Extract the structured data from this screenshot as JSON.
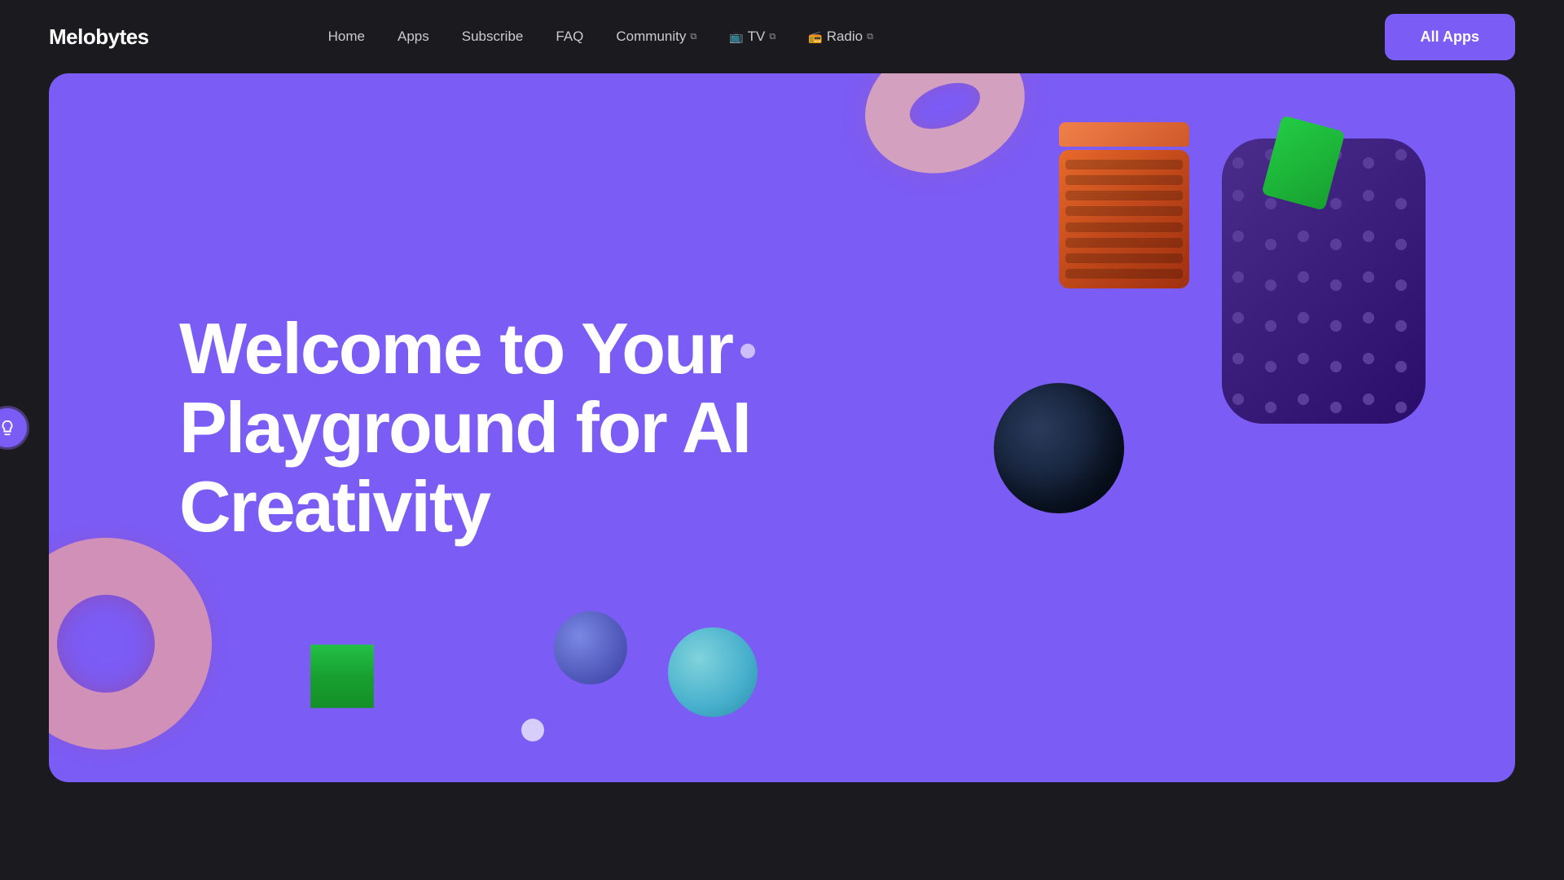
{
  "brand": {
    "name": "Melobytes"
  },
  "nav": {
    "links": [
      {
        "label": "Home",
        "external": false,
        "id": "home"
      },
      {
        "label": "Apps",
        "external": false,
        "id": "apps"
      },
      {
        "label": "Subscribe",
        "external": false,
        "id": "subscribe"
      },
      {
        "label": "FAQ",
        "external": false,
        "id": "faq"
      },
      {
        "label": "Community",
        "external": true,
        "id": "community"
      },
      {
        "label": "TV",
        "external": true,
        "id": "tv"
      },
      {
        "label": "Radio",
        "external": true,
        "id": "radio"
      }
    ],
    "cta_label": "All Apps"
  },
  "hero": {
    "title_line1": "Welcome to Your",
    "title_line2": "Playground for AI",
    "title_line3": "Creativity"
  },
  "side_button": {
    "label": "💡"
  }
}
